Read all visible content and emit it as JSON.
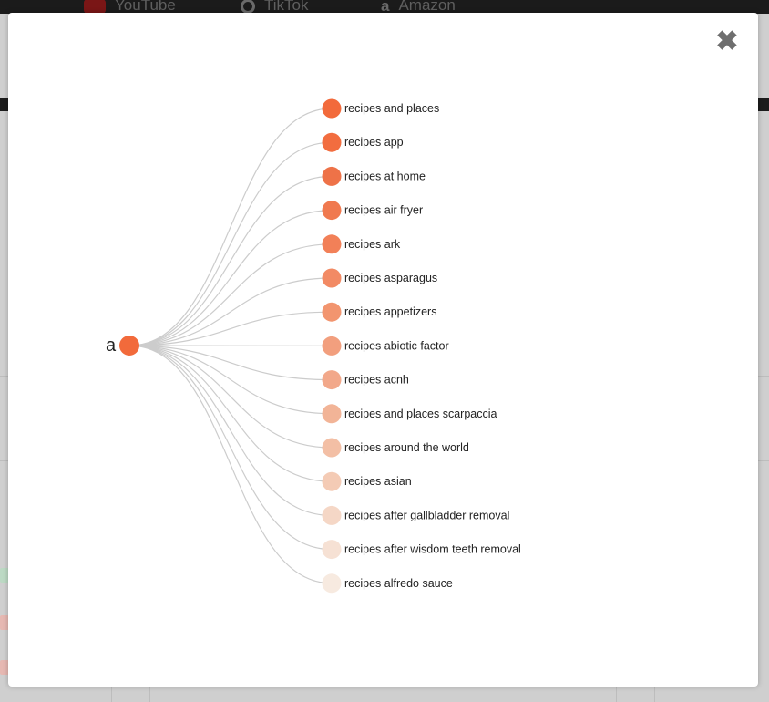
{
  "bookmarks": [
    {
      "label": "YouTube",
      "icon": "youtube-icon"
    },
    {
      "label": "TikTok",
      "icon": "tiktok-icon"
    },
    {
      "label": "Amazon",
      "icon": "amazon-icon"
    }
  ],
  "modal": {
    "close_label": "✖",
    "root": {
      "label": "a",
      "color": "#f26a3b"
    },
    "suggestions": [
      {
        "label": "recipes and places",
        "color": "#f26a3b"
      },
      {
        "label": "recipes app",
        "color": "#f26d3f"
      },
      {
        "label": "recipes at home",
        "color": "#ee7248"
      },
      {
        "label": "recipes air fryer",
        "color": "#f0794f"
      },
      {
        "label": "recipes ark",
        "color": "#f28058"
      },
      {
        "label": "recipes asparagus",
        "color": "#f28a64"
      },
      {
        "label": "recipes appetizers",
        "color": "#f2956f"
      },
      {
        "label": "recipes abiotic factor",
        "color": "#f29f7e"
      },
      {
        "label": "recipes acnh",
        "color": "#f2a88a"
      },
      {
        "label": "recipes and places scarpaccia",
        "color": "#f2b497"
      },
      {
        "label": "recipes around the world",
        "color": "#f3bfa5"
      },
      {
        "label": "recipes asian",
        "color": "#f4cbb5"
      },
      {
        "label": "recipes after gallbladder removal",
        "color": "#f5d7c6"
      },
      {
        "label": "recipes after wisdom teeth removal",
        "color": "#f6e1d4"
      },
      {
        "label": "recipes alfredo sauce",
        "color": "#f7eae0"
      }
    ]
  }
}
